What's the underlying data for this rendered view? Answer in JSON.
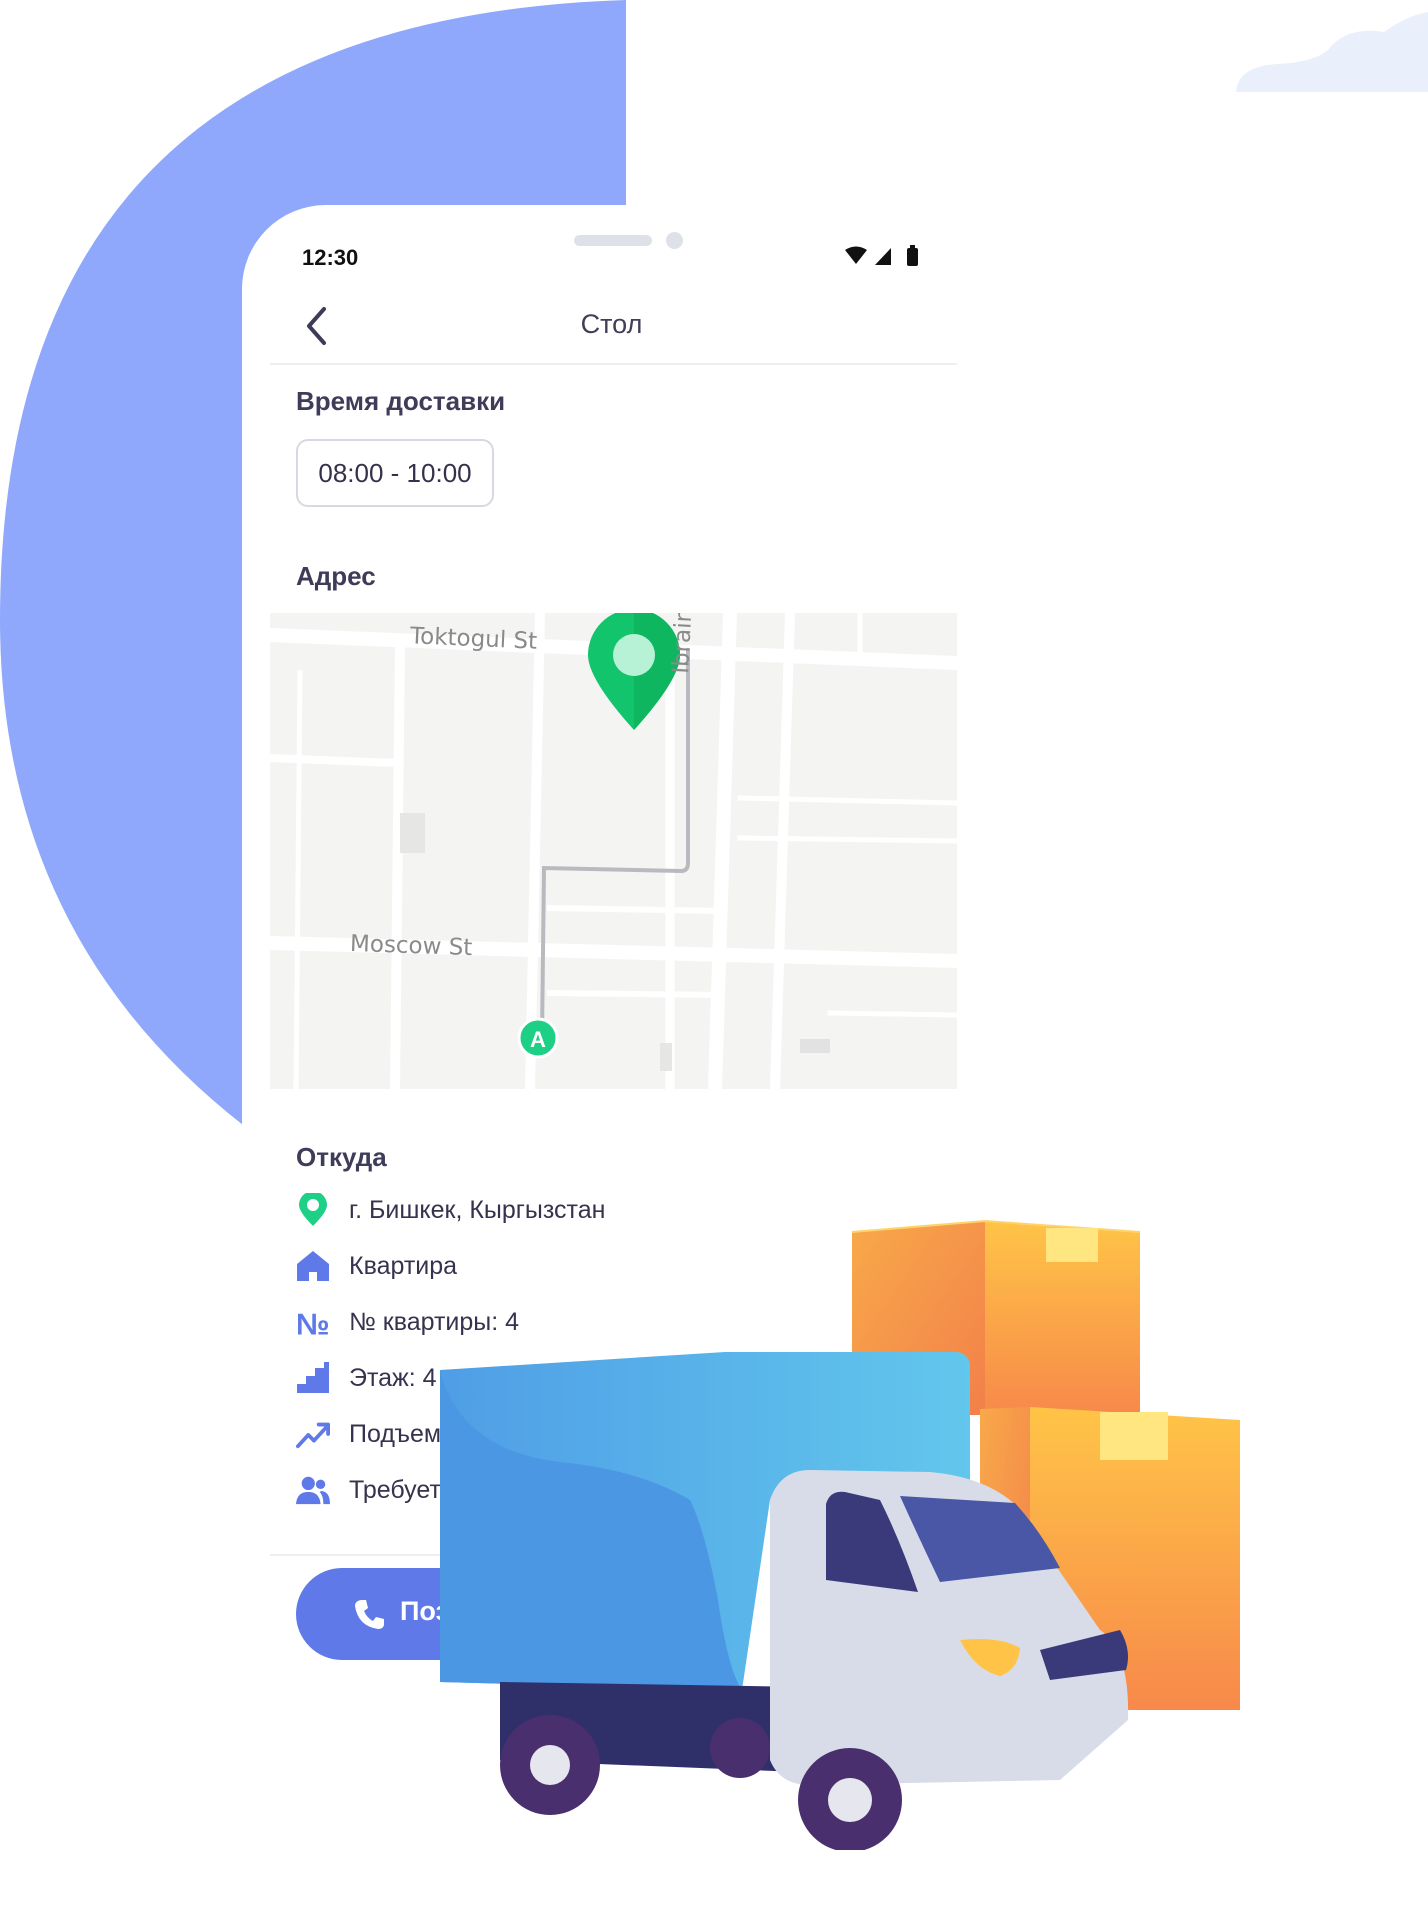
{
  "status_bar": {
    "time": "12:30"
  },
  "header": {
    "title": "Стол"
  },
  "delivery_time": {
    "title": "Время доставки",
    "value": "08:00 - 10:00"
  },
  "address": {
    "title": "Адрес",
    "map": {
      "streets": [
        "Toktogul St",
        "Moscow St",
        "Ibrain"
      ],
      "start_marker": "A",
      "pin_color": "#26d07c"
    }
  },
  "from": {
    "title": "Откуда",
    "items": [
      {
        "icon": "location-pin-icon",
        "text": "г. Бишкек, Кыргызстан"
      },
      {
        "icon": "home-icon",
        "text": "Квартира"
      },
      {
        "icon": "number-sign-icon",
        "text": "№ квартиры: 4"
      },
      {
        "icon": "stairs-icon",
        "text": "Этаж: 4"
      },
      {
        "icon": "trending-up-icon",
        "text": "Подъем"
      },
      {
        "icon": "people-icon",
        "text": "Требует"
      }
    ]
  },
  "call_button": {
    "label": "Поз"
  },
  "colors": {
    "accent": "#5f7ae8",
    "blob": "#8fa8fc",
    "text": "#3e3c58"
  }
}
